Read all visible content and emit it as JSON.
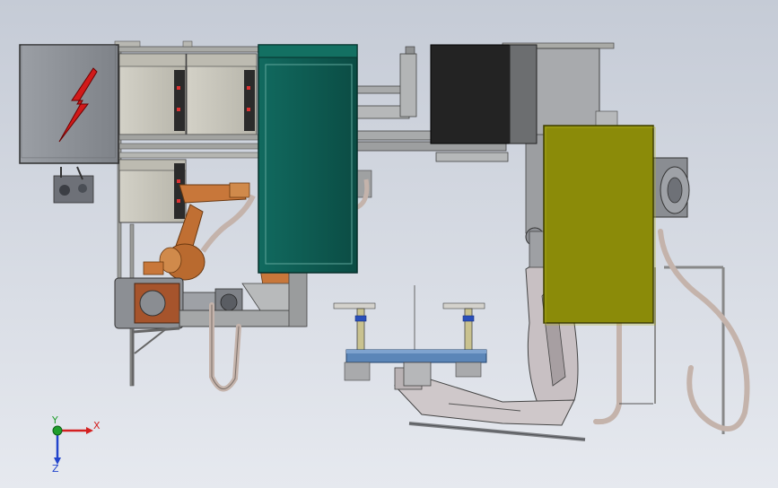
{
  "colors": {
    "background_top": "#c5cbd6",
    "background_bottom": "#e6e9ef",
    "electrical_cabinet": "#8e9297",
    "cabinet_beige": "#c9c7bd",
    "teal_enclosure": "#0e5b52",
    "black_unit": "#232323",
    "olive_panel": "#8b8b09",
    "robot_orange": "#c8773a",
    "conveyor_blue": "#5b86b8",
    "hose": "#c4b3ab",
    "lightning": "#d11a1a",
    "axis_x": "#d42020",
    "axis_y": "#1f9e2c",
    "axis_z": "#2244cc"
  },
  "axis_triad": {
    "x_label": "X",
    "y_label": "Y",
    "z_label": "Z"
  },
  "icons": {
    "warning_symbol": "high-voltage-lightning"
  }
}
